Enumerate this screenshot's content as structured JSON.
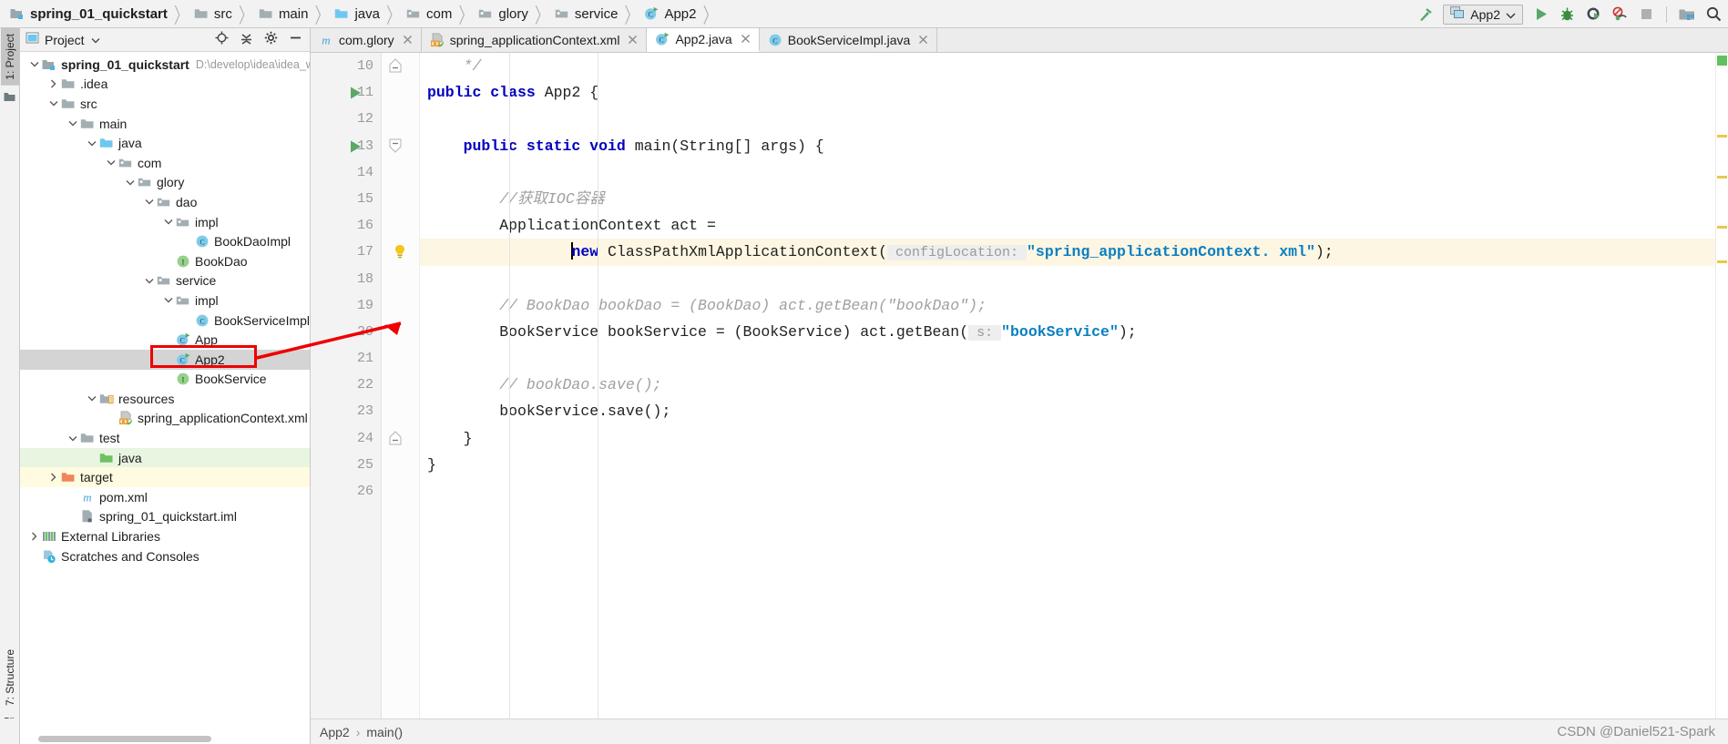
{
  "navbar": {
    "breadcrumbs": [
      {
        "label": "spring_01_quickstart",
        "icon": "module-icon",
        "bold": true
      },
      {
        "label": "src",
        "icon": "folder-icon",
        "bold": false
      },
      {
        "label": "main",
        "icon": "folder-icon",
        "bold": false
      },
      {
        "label": "java",
        "icon": "source-folder-icon",
        "bold": false
      },
      {
        "label": "com",
        "icon": "package-icon",
        "bold": false
      },
      {
        "label": "glory",
        "icon": "package-icon",
        "bold": false
      },
      {
        "label": "service",
        "icon": "package-icon",
        "bold": false
      },
      {
        "label": "App2",
        "icon": "java-class-runnable-icon",
        "bold": false
      }
    ],
    "run_config": {
      "label": "App2",
      "icon": "run-configuration-icon",
      "dropdown_icon": "chevron-down-icon"
    },
    "actions": [
      {
        "name": "build-hammer-icon",
        "title": "Build Project"
      },
      {
        "name": "run-icon",
        "title": "Run"
      },
      {
        "name": "debug-icon",
        "title": "Debug"
      },
      {
        "name": "run-with-coverage-icon",
        "title": "Run with Coverage"
      },
      {
        "name": "profile-icon",
        "title": "Profile"
      },
      {
        "name": "stop-icon",
        "title": "Stop"
      },
      {
        "name": "project-structure-icon",
        "title": "Project Structure"
      },
      {
        "name": "search-everywhere-icon",
        "title": "Search Everywhere"
      }
    ]
  },
  "left_strip": {
    "top_tab": "1: Project",
    "bottom_tab": "7: Structure",
    "favorites_icon": "favorites-icon",
    "terminal_icon": "terminal-icon"
  },
  "project_panel": {
    "title": "Project",
    "title_icon": "project-view-icon",
    "dropdown_icon": "chevron-down-icon",
    "actions": [
      {
        "name": "locate-in-tree-icon",
        "title": "Select Opened File"
      },
      {
        "name": "collapse-all-icon",
        "title": "Collapse All"
      },
      {
        "name": "settings-gear-icon",
        "title": "Settings"
      },
      {
        "name": "hide-panel-icon",
        "title": "Hide"
      }
    ],
    "tree": [
      {
        "label": "spring_01_quickstart",
        "path": "D:\\develop\\idea\\idea_w",
        "icon": "module-icon",
        "indent": 0,
        "arrow": "down",
        "bold": true,
        "state": "none"
      },
      {
        "label": ".idea",
        "path": "",
        "icon": "folder-icon",
        "indent": 1,
        "arrow": "right",
        "bold": false,
        "state": "none"
      },
      {
        "label": "src",
        "path": "",
        "icon": "folder-icon",
        "indent": 1,
        "arrow": "down",
        "bold": false,
        "state": "none"
      },
      {
        "label": "main",
        "path": "",
        "icon": "folder-icon",
        "indent": 2,
        "arrow": "down",
        "bold": false,
        "state": "none"
      },
      {
        "label": "java",
        "path": "",
        "icon": "source-folder-icon",
        "indent": 3,
        "arrow": "down",
        "bold": false,
        "state": "none"
      },
      {
        "label": "com",
        "path": "",
        "icon": "package-icon",
        "indent": 4,
        "arrow": "down",
        "bold": false,
        "state": "none"
      },
      {
        "label": "glory",
        "path": "",
        "icon": "package-icon",
        "indent": 5,
        "arrow": "down",
        "bold": false,
        "state": "none"
      },
      {
        "label": "dao",
        "path": "",
        "icon": "package-icon",
        "indent": 6,
        "arrow": "down",
        "bold": false,
        "state": "none"
      },
      {
        "label": "impl",
        "path": "",
        "icon": "package-icon",
        "indent": 7,
        "arrow": "down",
        "bold": false,
        "state": "none"
      },
      {
        "label": "BookDaoImpl",
        "path": "",
        "icon": "java-class-icon",
        "indent": 8,
        "arrow": "none",
        "bold": false,
        "state": "none"
      },
      {
        "label": "BookDao",
        "path": "",
        "icon": "java-interface-icon",
        "indent": 7,
        "arrow": "none",
        "bold": false,
        "state": "none"
      },
      {
        "label": "service",
        "path": "",
        "icon": "package-icon",
        "indent": 6,
        "arrow": "down",
        "bold": false,
        "state": "none"
      },
      {
        "label": "impl",
        "path": "",
        "icon": "package-icon",
        "indent": 7,
        "arrow": "down",
        "bold": false,
        "state": "none"
      },
      {
        "label": "BookServiceImpl",
        "path": "",
        "icon": "java-class-icon",
        "indent": 8,
        "arrow": "none",
        "bold": false,
        "state": "none"
      },
      {
        "label": "App",
        "path": "",
        "icon": "java-class-runnable-icon",
        "indent": 7,
        "arrow": "none",
        "bold": false,
        "state": "none"
      },
      {
        "label": "App2",
        "path": "",
        "icon": "java-class-runnable-icon",
        "indent": 7,
        "arrow": "none",
        "bold": false,
        "state": "selected"
      },
      {
        "label": "BookService",
        "path": "",
        "icon": "java-interface-icon",
        "indent": 7,
        "arrow": "none",
        "bold": false,
        "state": "none"
      },
      {
        "label": "resources",
        "path": "",
        "icon": "resources-folder-icon",
        "indent": 3,
        "arrow": "down",
        "bold": false,
        "state": "none"
      },
      {
        "label": "spring_applicationContext.xml",
        "path": "",
        "icon": "spring-xml-icon",
        "indent": 4,
        "arrow": "none",
        "bold": false,
        "state": "none"
      },
      {
        "label": "test",
        "path": "",
        "icon": "folder-icon",
        "indent": 2,
        "arrow": "down",
        "bold": false,
        "state": "none"
      },
      {
        "label": "java",
        "path": "",
        "icon": "test-source-folder-icon",
        "indent": 3,
        "arrow": "none",
        "bold": false,
        "state": "green"
      },
      {
        "label": "target",
        "path": "",
        "icon": "excluded-folder-icon",
        "indent": 1,
        "arrow": "right",
        "bold": false,
        "state": "yellow"
      },
      {
        "label": "pom.xml",
        "path": "",
        "icon": "maven-icon",
        "indent": 2,
        "arrow": "none",
        "bold": false,
        "state": "none"
      },
      {
        "label": "spring_01_quickstart.iml",
        "path": "",
        "icon": "iml-file-icon",
        "indent": 2,
        "arrow": "none",
        "bold": false,
        "state": "none"
      },
      {
        "label": "External Libraries",
        "path": "",
        "icon": "external-libraries-icon",
        "indent": 0,
        "arrow": "right",
        "bold": false,
        "state": "none"
      },
      {
        "label": "Scratches and Consoles",
        "path": "",
        "icon": "scratches-icon",
        "indent": 0,
        "arrow": "none",
        "bold": false,
        "state": "none"
      }
    ]
  },
  "editor": {
    "tabs": [
      {
        "label": "com.glory",
        "icon": "maven-module-icon",
        "active": false,
        "close_icon": "close-icon"
      },
      {
        "label": "spring_applicationContext.xml",
        "icon": "spring-xml-icon",
        "active": false,
        "close_icon": "close-icon"
      },
      {
        "label": "App2.java",
        "icon": "java-class-runnable-icon",
        "active": true,
        "close_icon": "close-icon"
      },
      {
        "label": "BookServiceImpl.java",
        "icon": "java-class-icon",
        "active": false,
        "close_icon": "close-icon"
      }
    ],
    "lines": [
      {
        "num": "10",
        "gutter": {
          "run": false,
          "fold": "end",
          "bulb": false
        },
        "highlight": false,
        "tokens": [
          {
            "t": "pl",
            "v": "    "
          },
          {
            "t": "cm",
            "v": "*/"
          }
        ]
      },
      {
        "num": "11",
        "gutter": {
          "run": true,
          "fold": "none",
          "bulb": false
        },
        "highlight": false,
        "tokens": [
          {
            "t": "kw",
            "v": "public class "
          },
          {
            "t": "pl",
            "v": "App2 {"
          }
        ]
      },
      {
        "num": "12",
        "gutter": {
          "run": false,
          "fold": "none",
          "bulb": false
        },
        "highlight": false,
        "tokens": [
          {
            "t": "pl",
            "v": ""
          }
        ]
      },
      {
        "num": "13",
        "gutter": {
          "run": true,
          "fold": "start",
          "bulb": false
        },
        "highlight": false,
        "tokens": [
          {
            "t": "pl",
            "v": "    "
          },
          {
            "t": "kw",
            "v": "public static void "
          },
          {
            "t": "pl",
            "v": "main(String[] args) {"
          }
        ]
      },
      {
        "num": "14",
        "gutter": {
          "run": false,
          "fold": "none",
          "bulb": false
        },
        "highlight": false,
        "tokens": [
          {
            "t": "pl",
            "v": ""
          }
        ]
      },
      {
        "num": "15",
        "gutter": {
          "run": false,
          "fold": "none",
          "bulb": false
        },
        "highlight": false,
        "tokens": [
          {
            "t": "pl",
            "v": "        "
          },
          {
            "t": "cm",
            "v": "//获取IOC容器"
          }
        ]
      },
      {
        "num": "16",
        "gutter": {
          "run": false,
          "fold": "none",
          "bulb": false
        },
        "highlight": false,
        "tokens": [
          {
            "t": "pl",
            "v": "        ApplicationContext act ="
          }
        ]
      },
      {
        "num": "17",
        "gutter": {
          "run": false,
          "fold": "none",
          "bulb": true
        },
        "highlight": true,
        "tokens": [
          {
            "t": "pl",
            "v": "                "
          },
          {
            "t": "caret",
            "v": ""
          },
          {
            "t": "kw",
            "v": "new "
          },
          {
            "t": "pl",
            "v": "ClassPathXmlApplicationContext("
          },
          {
            "t": "hint",
            "v": " configLocation: "
          },
          {
            "t": "str",
            "v": "\"spring_applicationContext. xml\""
          },
          {
            "t": "pl",
            "v": ");"
          }
        ]
      },
      {
        "num": "18",
        "gutter": {
          "run": false,
          "fold": "none",
          "bulb": false
        },
        "highlight": false,
        "tokens": [
          {
            "t": "pl",
            "v": ""
          }
        ]
      },
      {
        "num": "19",
        "gutter": {
          "run": false,
          "fold": "none",
          "bulb": false
        },
        "highlight": false,
        "tokens": [
          {
            "t": "pl",
            "v": "        "
          },
          {
            "t": "cm",
            "v": "// BookDao bookDao = (BookDao) act.getBean(\"bookDao\");"
          }
        ]
      },
      {
        "num": "20",
        "gutter": {
          "run": false,
          "fold": "none",
          "bulb": false
        },
        "highlight": false,
        "tokens": [
          {
            "t": "pl",
            "v": "        BookService bookService = (BookService) act.getBean("
          },
          {
            "t": "hint",
            "v": " s: "
          },
          {
            "t": "str",
            "v": "\"bookService\""
          },
          {
            "t": "pl",
            "v": ");"
          }
        ]
      },
      {
        "num": "21",
        "gutter": {
          "run": false,
          "fold": "none",
          "bulb": false
        },
        "highlight": false,
        "tokens": [
          {
            "t": "pl",
            "v": ""
          }
        ]
      },
      {
        "num": "22",
        "gutter": {
          "run": false,
          "fold": "none",
          "bulb": false
        },
        "highlight": false,
        "tokens": [
          {
            "t": "pl",
            "v": "        "
          },
          {
            "t": "cm",
            "v": "// bookDao.save();"
          }
        ]
      },
      {
        "num": "23",
        "gutter": {
          "run": false,
          "fold": "none",
          "bulb": false
        },
        "highlight": false,
        "tokens": [
          {
            "t": "pl",
            "v": "        bookService.save();"
          }
        ]
      },
      {
        "num": "24",
        "gutter": {
          "run": false,
          "fold": "end",
          "bulb": false
        },
        "highlight": false,
        "tokens": [
          {
            "t": "pl",
            "v": "    }"
          }
        ]
      },
      {
        "num": "25",
        "gutter": {
          "run": false,
          "fold": "none",
          "bulb": false
        },
        "highlight": false,
        "tokens": [
          {
            "t": "pl",
            "v": "}"
          }
        ]
      },
      {
        "num": "26",
        "gutter": {
          "run": false,
          "fold": "none",
          "bulb": false
        },
        "highlight": false,
        "tokens": [
          {
            "t": "pl",
            "v": ""
          }
        ]
      }
    ],
    "breadcrumb": {
      "class": "App2",
      "separator": "›",
      "method": "main()"
    },
    "watermark": "CSDN @Daniel521-Spark"
  },
  "colors": {
    "selection_gray": "#d4d4d4",
    "annotation_red": "#ee0000",
    "highlight_line": "#fdf6e3",
    "keyword_blue": "#0000c0",
    "string_blue": "#0b7fc0",
    "comment_gray": "#a0a0a0",
    "green_accent": "#59a869",
    "test_green": "#e8f5e1",
    "excluded_yellow": "#fffbe0"
  }
}
